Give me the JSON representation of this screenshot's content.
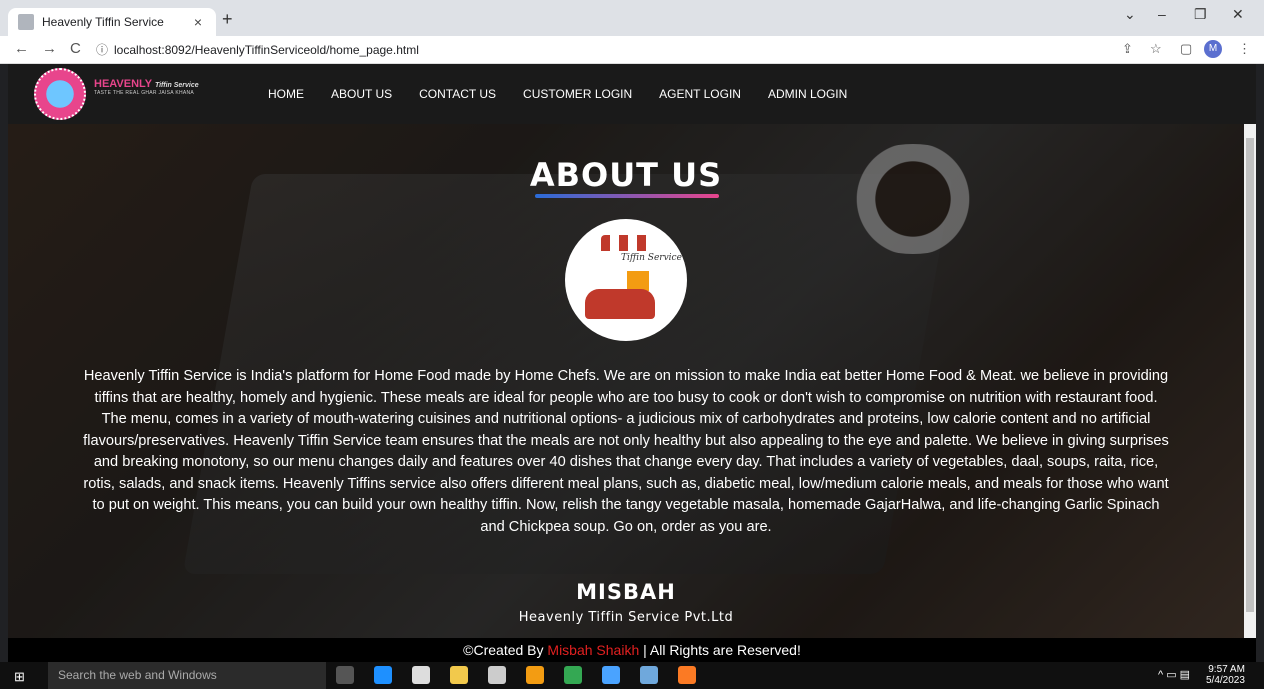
{
  "browser": {
    "tab_title": "Heavenly Tiffin Service",
    "tab_close": "×",
    "new_tab": "+",
    "url": "localhost:8092/HeavenlyTiffinServiceold/home_page.html",
    "profile_initial": "M",
    "back": "←",
    "forward": "→",
    "reload": "C",
    "info": "ⓘ",
    "minimize": "–",
    "restore": "❐",
    "close": "✕",
    "collapse": "⌄",
    "share": "⇪",
    "star": "☆",
    "sidepanel": "▢",
    "menu": "⋮"
  },
  "site": {
    "logo_name": "HEAVENLY",
    "logo_name_small": "Tiffin Service",
    "logo_tagline": "TASTE THE REAL GHAR JAISA KHANA",
    "nav": [
      "HOME",
      "ABOUT US",
      "CONTACT US",
      "CUSTOMER LOGIN",
      "AGENT LOGIN",
      "ADMIN LOGIN"
    ],
    "heading": "ABOUT US",
    "badge_sign": "Tiffin Service",
    "paragraph": "Heavenly Tiffin Service is India's platform for Home Food made by Home Chefs. We are on mission to make India eat better Home Food & Meat. we believe in providing tiffins that are healthy, homely and hygienic. These meals are ideal for people who are too busy to cook or don't wish to compromise on nutrition with restaurant food. The menu, comes in a variety of mouth-watering cuisines and nutritional options- a judicious mix of carbohydrates and proteins, low calorie content and no artificial flavours/preservatives. Heavenly Tiffin Service team ensures that the meals are not only healthy but also appealing to the eye and palette. We believe in giving surprises and breaking monotony, so our menu changes daily and features over 40 dishes that change every day. That includes a variety of vegetables, daal, soups, raita, rice, rotis, salads, and snack items. Heavenly Tiffins service also offers different meal plans, such as, diabetic meal, low/medium calorie meals, and meals for those who want to put on weight. This means, you can build your own healthy tiffin. Now, relish the tangy vegetable masala, homemade GajarHalwa, and life-changing Garlic Spinach and Chickpea soup. Go on, order as you are.",
    "signature_name": "MISBAH",
    "signature_company": "Heavenly Tiffin Service Pvt.Ltd"
  },
  "footer": {
    "prefix": "©Created By ",
    "author": "Misbah Shaikh",
    "suffix": " | All Rights are Reserved!"
  },
  "taskbar": {
    "start": "⊞",
    "search_placeholder": "Search the web and Windows",
    "time": "9:57 AM",
    "date": "5/4/2023",
    "tray": "^ ▭ ▤",
    "apps": [
      {
        "name": "task-view",
        "color": "#555555"
      },
      {
        "name": "edge",
        "color": "#1e90ff"
      },
      {
        "name": "store",
        "color": "#dddddd"
      },
      {
        "name": "file-explorer",
        "color": "#f2c94c"
      },
      {
        "name": "camera",
        "color": "#cccccc"
      },
      {
        "name": "sublime",
        "color": "#f39c12"
      },
      {
        "name": "chrome",
        "color": "#34a853"
      },
      {
        "name": "app-blue",
        "color": "#4aa3ff"
      },
      {
        "name": "app-notes",
        "color": "#6fa8dc"
      },
      {
        "name": "xampp",
        "color": "#fb7a24"
      }
    ]
  }
}
